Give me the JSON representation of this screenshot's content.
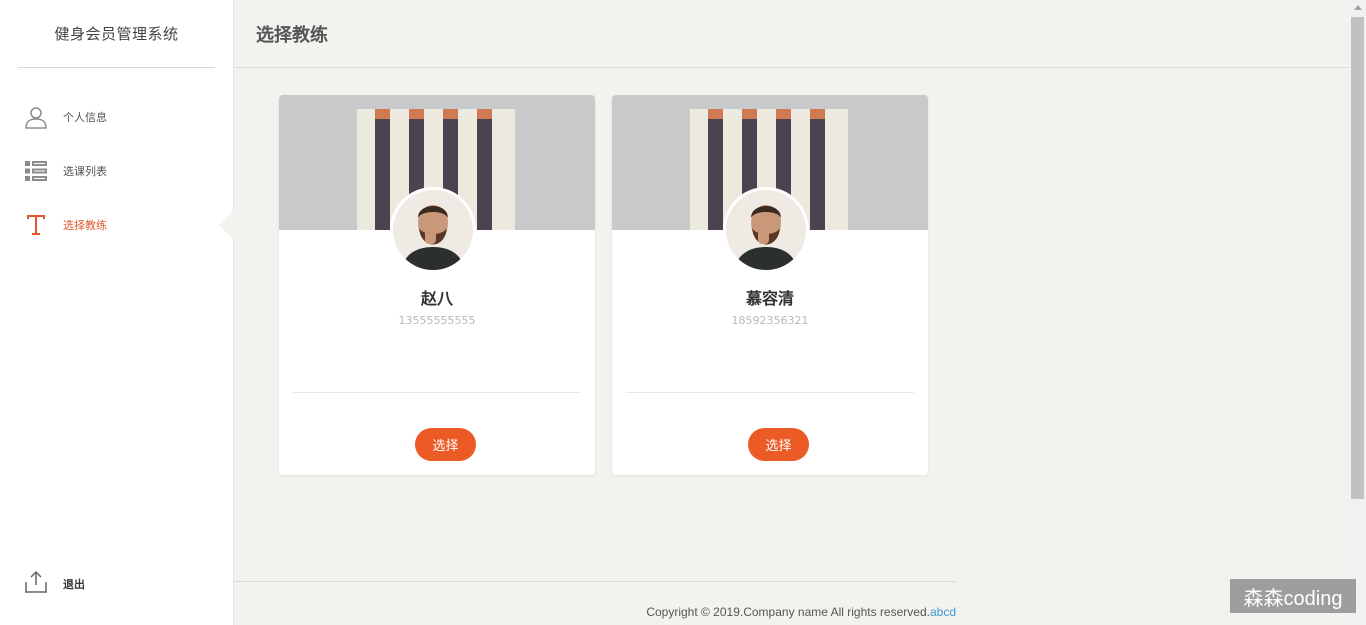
{
  "app": {
    "title": "健身会员管理系统"
  },
  "sidebar": {
    "items": [
      {
        "label": "个人信息",
        "icon": "user-icon"
      },
      {
        "label": "选课列表",
        "icon": "list-icon"
      },
      {
        "label": "选择教练",
        "icon": "text-t-icon",
        "active": true
      }
    ],
    "logout_label": "退出"
  },
  "header": {
    "title": "选择教练"
  },
  "coaches": [
    {
      "name": "赵八",
      "phone": "13555555555",
      "button_label": "选择"
    },
    {
      "name": "慕容清",
      "phone": "18592356321",
      "button_label": "选择"
    }
  ],
  "footer": {
    "copyright": "Copyright © 2019.Company name All rights reserved.",
    "link_text": "abcd"
  },
  "watermark": "森森coding",
  "colors": {
    "accent": "#ec5a26",
    "active_text": "#e0582a",
    "link": "#3f9bd0"
  }
}
